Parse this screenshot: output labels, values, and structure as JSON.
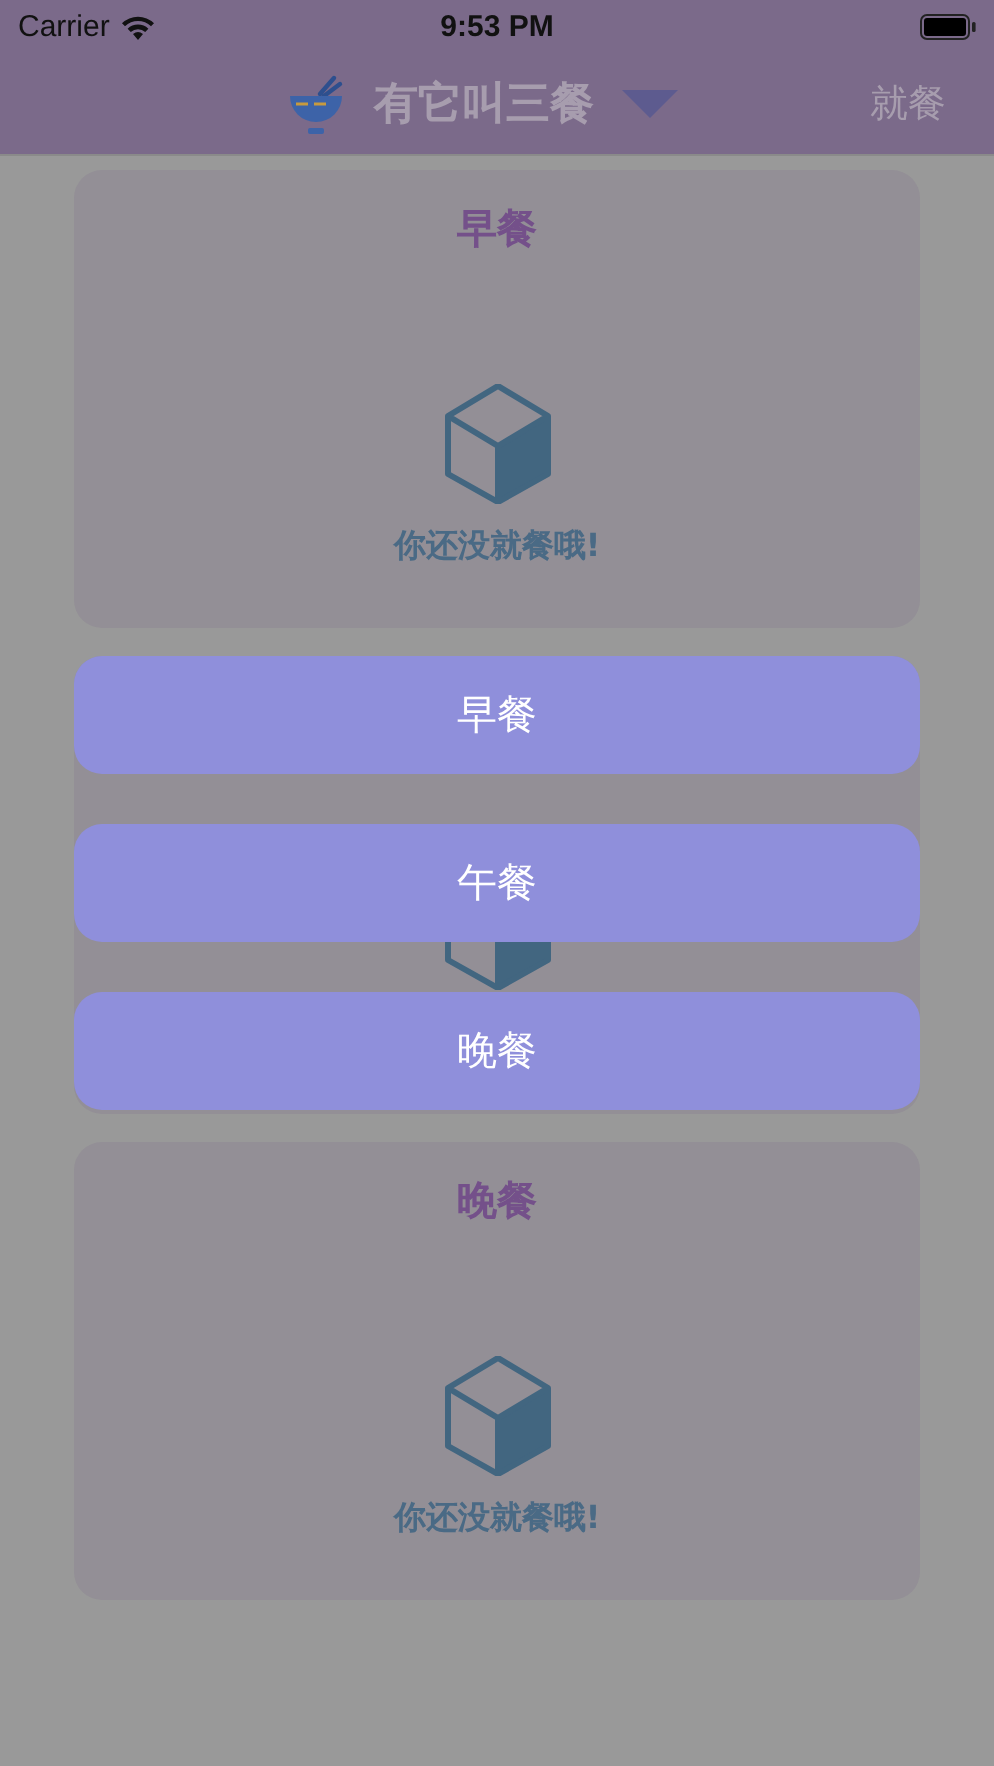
{
  "status_bar": {
    "carrier": "Carrier",
    "time": "9:53 PM"
  },
  "nav_bar": {
    "title": "有它叫三餐",
    "action": "就餐"
  },
  "cards": [
    {
      "title": "早餐",
      "message": "你还没就餐哦!"
    },
    {
      "covered": true
    },
    {
      "title": "晚餐",
      "message": "你还没就餐哦!"
    }
  ],
  "menu": [
    "早餐",
    "午餐",
    "晚餐"
  ]
}
